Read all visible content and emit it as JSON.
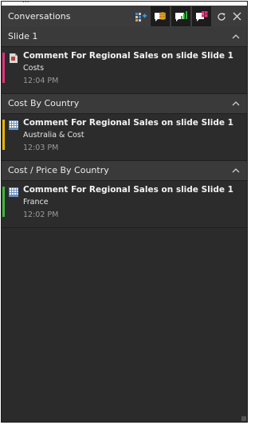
{
  "panel": {
    "title": "Conversations",
    "behind_fragment": "...",
    "toolbar": [
      {
        "name": "add-chart-icon"
      },
      {
        "name": "stack-comment-icon"
      },
      {
        "name": "chart-comment-icon"
      },
      {
        "name": "grid-comment-icon"
      },
      {
        "name": "refresh-icon"
      },
      {
        "name": "close-icon"
      }
    ]
  },
  "sections": [
    {
      "title": "Slide 1",
      "comments": [
        {
          "title": "Comment For Regional Sales on slide Slide 1",
          "subtitle": "Costs",
          "time": "12:04 PM",
          "accent": "#e2317a",
          "icon": "document-icon"
        }
      ]
    },
    {
      "title": "Cost By Country",
      "comments": [
        {
          "title": "Comment For Regional Sales on slide Slide 1",
          "subtitle": "Australia & Cost",
          "time": "12:03 PM",
          "accent": "#e6b400",
          "icon": "grid-icon"
        }
      ]
    },
    {
      "title": "Cost / Price By Country",
      "comments": [
        {
          "title": "Comment For Regional Sales on slide Slide 1",
          "subtitle": "France",
          "time": "12:02 PM",
          "accent": "#3bb83b",
          "icon": "grid-icon"
        }
      ]
    }
  ]
}
